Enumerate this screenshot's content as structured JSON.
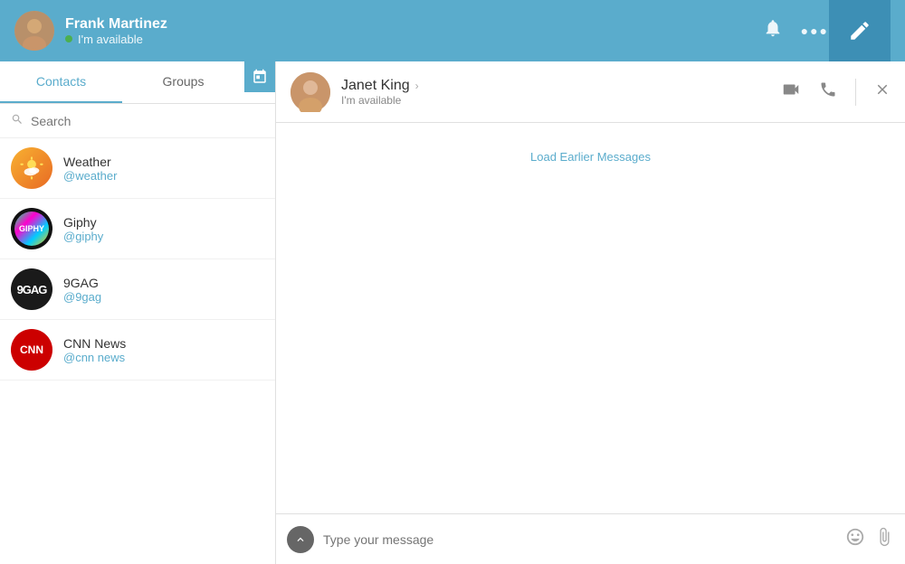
{
  "header": {
    "user_name": "Frank Martinez",
    "user_status": "I'm available",
    "avatar_emoji": "👨"
  },
  "sidebar": {
    "tabs": [
      {
        "label": "Contacts",
        "active": true
      },
      {
        "label": "Groups",
        "active": false
      }
    ],
    "search_placeholder": "Search",
    "contacts": [
      {
        "name": "Weather",
        "handle": "@weather",
        "type": "weather"
      },
      {
        "name": "Giphy",
        "handle": "@giphy",
        "type": "giphy"
      },
      {
        "name": "9GAG",
        "handle": "@9gag",
        "type": "ninegag"
      },
      {
        "name": "CNN News",
        "handle": "@cnn news",
        "type": "cnn"
      }
    ]
  },
  "chat": {
    "contact_name": "Janet King",
    "contact_status": "I'm available",
    "load_earlier_label": "Load Earlier Messages",
    "input_placeholder": "Type your message"
  },
  "icons": {
    "bell": "🔔",
    "more": "•••",
    "compose": "✏️",
    "video": "📹",
    "phone": "📞",
    "close": "✕",
    "scroll_up": "↑",
    "emoji": "😊",
    "attach": "📎",
    "search": "🔍",
    "chevron": "›"
  }
}
